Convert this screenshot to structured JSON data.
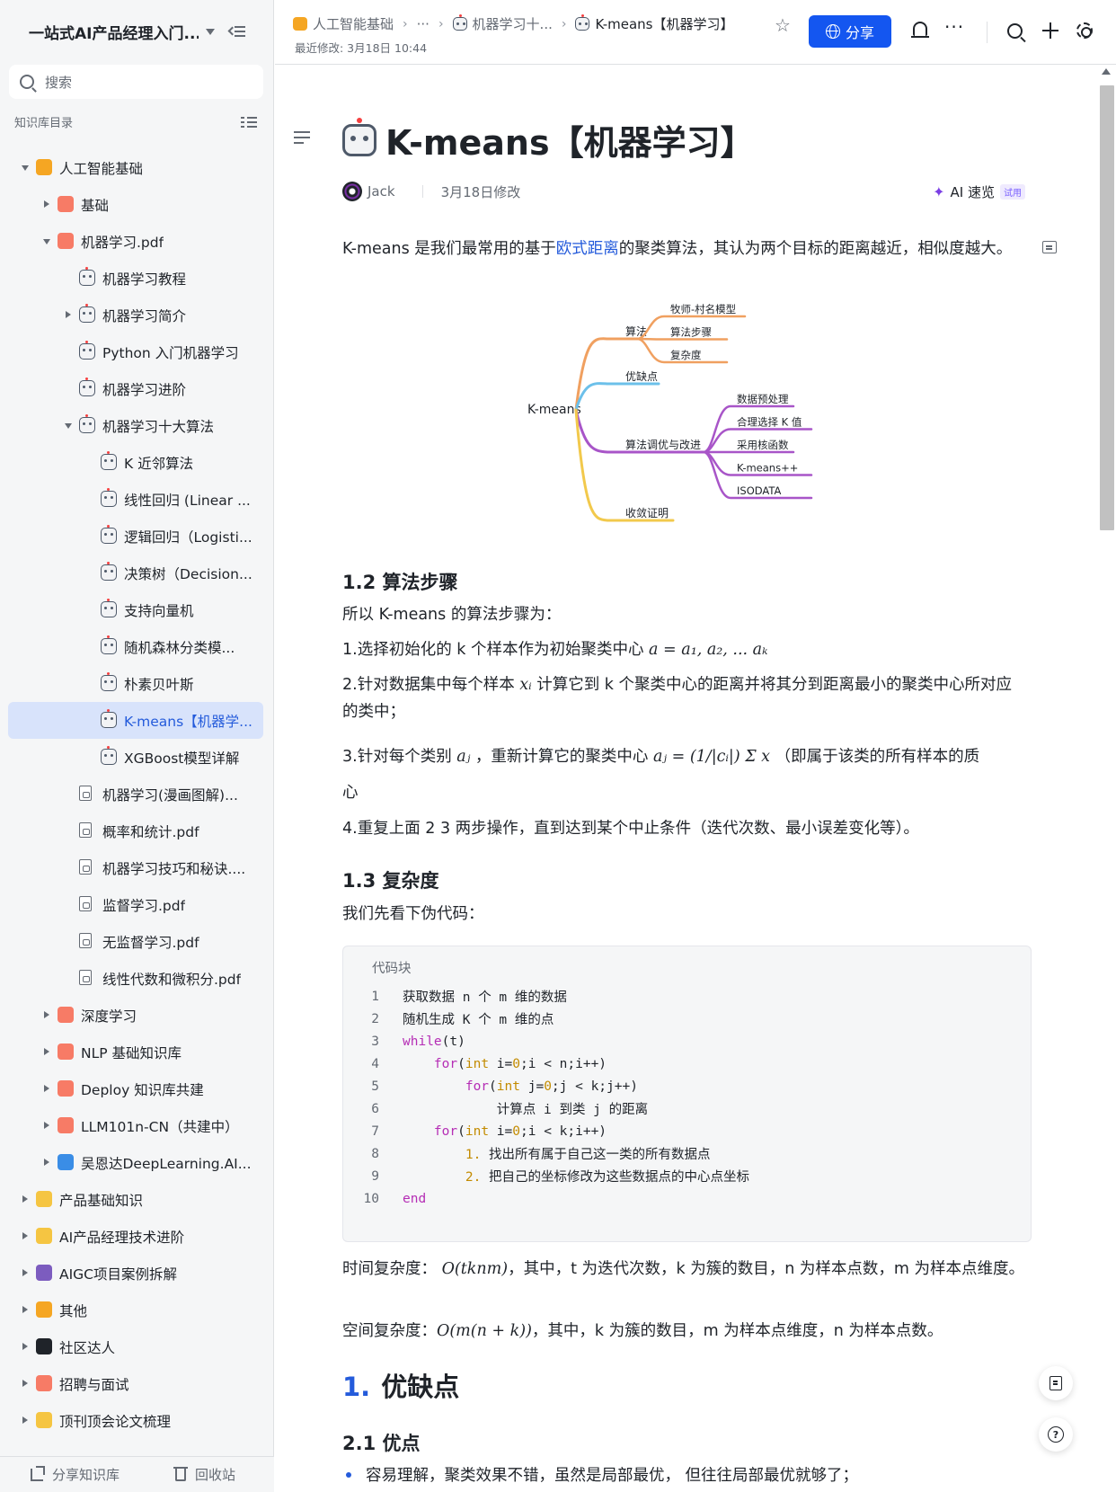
{
  "sidebar": {
    "title": "一站式AI产品经理入门...",
    "search_placeholder": "搜索",
    "section_label": "知识库目录",
    "items": [
      {
        "label": "人工智能基础",
        "level": 0,
        "arrow": "down",
        "icon": "smile-heart-icon",
        "icon_color": "#f5a623"
      },
      {
        "label": "基础",
        "level": 1,
        "arrow": "right",
        "icon": "grid-icon",
        "icon_color": "#f77b66"
      },
      {
        "label": "机器学习.pdf",
        "level": 1,
        "arrow": "down",
        "icon": "layers-icon",
        "icon_color": "#f77b66"
      },
      {
        "label": "机器学习教程",
        "level": 2,
        "arrow": "",
        "icon": "robot-icon"
      },
      {
        "label": "机器学习简介",
        "level": 2,
        "arrow": "right",
        "icon": "robot-icon"
      },
      {
        "label": "Python 入门机器学习",
        "level": 2,
        "arrow": "",
        "icon": "robot-icon"
      },
      {
        "label": "机器学习进阶",
        "level": 2,
        "arrow": "",
        "icon": "robot-icon"
      },
      {
        "label": "机器学习十大算法",
        "level": 2,
        "arrow": "down",
        "icon": "robot-icon"
      },
      {
        "label": "K 近邻算法",
        "level": 3,
        "arrow": "",
        "icon": "robot-icon"
      },
      {
        "label": "线性回归 (Linear ...",
        "level": 3,
        "arrow": "",
        "icon": "robot-icon"
      },
      {
        "label": "逻辑回归（Logisti...",
        "level": 3,
        "arrow": "",
        "icon": "robot-icon"
      },
      {
        "label": "决策树（Decision...",
        "level": 3,
        "arrow": "",
        "icon": "robot-icon"
      },
      {
        "label": "支持向量机",
        "level": 3,
        "arrow": "",
        "icon": "robot-icon"
      },
      {
        "label": "随机森林分类模...",
        "level": 3,
        "arrow": "",
        "icon": "robot-icon"
      },
      {
        "label": "朴素贝叶斯",
        "level": 3,
        "arrow": "",
        "icon": "robot-icon"
      },
      {
        "label": "K-means【机器学...",
        "level": 3,
        "arrow": "",
        "icon": "robot-icon",
        "active": true
      },
      {
        "label": "XGBoost模型详解",
        "level": 3,
        "arrow": "",
        "icon": "robot-icon"
      },
      {
        "label": "机器学习(漫画图解)...",
        "level": 2,
        "arrow": "",
        "icon": "pdf-icon"
      },
      {
        "label": "概率和统计.pdf",
        "level": 2,
        "arrow": "",
        "icon": "pdf-icon"
      },
      {
        "label": "机器学习技巧和秘诀....",
        "level": 2,
        "arrow": "",
        "icon": "pdf-icon"
      },
      {
        "label": "监督学习.pdf",
        "level": 2,
        "arrow": "",
        "icon": "pdf-icon"
      },
      {
        "label": "无监督学习.pdf",
        "level": 2,
        "arrow": "",
        "icon": "pdf-icon"
      },
      {
        "label": "线性代数和微积分.pdf",
        "level": 2,
        "arrow": "",
        "icon": "pdf-icon"
      },
      {
        "label": "深度学习",
        "level": 1,
        "arrow": "right",
        "icon": "layers-icon",
        "icon_color": "#f77b66"
      },
      {
        "label": "NLP 基础知识库",
        "level": 1,
        "arrow": "right",
        "icon": "layers-icon",
        "icon_color": "#f77b66"
      },
      {
        "label": "Deploy 知识库共建",
        "level": 1,
        "arrow": "right",
        "icon": "chart-icon",
        "icon_color": "#f77b66"
      },
      {
        "label": "LLM101n-CN（共建中）",
        "level": 1,
        "arrow": "right",
        "icon": "monitor-icon",
        "icon_color": "#f77b66"
      },
      {
        "label": "吴恩达DeepLearning.AI...",
        "level": 1,
        "arrow": "right",
        "icon": "teacher-icon",
        "icon_color": "#3a8de6"
      },
      {
        "label": "产品基础知识",
        "level": 0,
        "arrow": "right",
        "icon": "dizzy-icon",
        "icon_color": "#f5c542"
      },
      {
        "label": "AI产品经理技术进阶",
        "level": 0,
        "arrow": "right",
        "icon": "muscle-icon",
        "icon_color": "#f5c542"
      },
      {
        "label": "AIGC项目案例拆解",
        "level": 0,
        "arrow": "right",
        "icon": "floppy-icon",
        "icon_color": "#7c5cbf"
      },
      {
        "label": "其他",
        "level": 0,
        "arrow": "right",
        "icon": "box-icon",
        "icon_color": "#f5a623"
      },
      {
        "label": "社区达人",
        "level": 0,
        "arrow": "right",
        "icon": "eyes-icon",
        "icon_color": "#1f2329"
      },
      {
        "label": "招聘与面试",
        "level": 0,
        "arrow": "right",
        "icon": "mail-icon",
        "icon_color": "#f77b66"
      },
      {
        "label": "顶刊顶会论文梳理",
        "level": 0,
        "arrow": "right",
        "icon": "scroll-icon",
        "icon_color": "#f5c542"
      }
    ],
    "footer": {
      "share_label": "分享知识库",
      "trash_label": "回收站"
    }
  },
  "topbar": {
    "crumbs": [
      {
        "label": "人工智能基础",
        "icon": "smile-heart-icon"
      },
      {
        "label": "···",
        "icon": ""
      },
      {
        "label": "机器学习十...",
        "icon": "robot-icon"
      },
      {
        "label": "K-means【机器学习】",
        "icon": "robot-icon",
        "current": true
      }
    ],
    "modified": "最近修改: 3月18日 10:44",
    "share_label": "分享",
    "accent": "#1456f0"
  },
  "doc": {
    "title": "K-means【机器学习】",
    "author": "Jack",
    "modified": "3月18日修改",
    "ai_read": "AI 速览",
    "trial": "试用",
    "intro_a": "K-means 是我们最常用的基于",
    "intro_link": "欧式距离",
    "intro_b": "的聚类算法，其认为两个目标的距离越近，相似度越大。",
    "mindmap": {
      "root": "K-means",
      "branches": [
        {
          "label": "算法",
          "color": "#f0a060",
          "children": [
            "牧师-村名模型",
            "算法步骤",
            "复杂度"
          ]
        },
        {
          "label": "优缺点",
          "color": "#6cc0ea",
          "children": []
        },
        {
          "label": "算法调优与改进",
          "color": "#a855c8",
          "children": [
            "数据预处理",
            "合理选择 K 值",
            "采用核函数",
            "K-means++",
            "ISODATA"
          ]
        },
        {
          "label": "收敛证明",
          "color": "#f2c94c",
          "children": []
        }
      ]
    },
    "h_steps": "1.2 算法步骤",
    "steps_intro": "所以 K-means 的算法步骤为：",
    "step1": "1.选择初始化的 k 个样本作为初始聚类中心",
    "step1_math": "a = a₁, a₂, ... aₖ",
    "step2_a": "2.针对数据集中每个样本",
    "step2_math": "xᵢ",
    "step2_b": "计算它到 k 个聚类中心的距离并将其分到距离最小的聚类中心所对应的类中；",
    "step3_a": "3.针对每个类别",
    "step3_math1": "aⱼ",
    "step3_b": "，重新计算它的聚类中心",
    "step3_math2": "aⱼ = (1/|cᵢ|) Σ x",
    "step3_c": "（即属于该类的所有样本的质",
    "step3_d": "心",
    "step4": "4.重复上面 2 3 两步操作，直到达到某个中止条件（迭代次数、最小误差变化等）。",
    "h_complexity": "1.3 复杂度",
    "pseudo_intro": "我们先看下伪代码：",
    "code_label": "代码块",
    "code": [
      "获取数据 n 个 m 维的数据",
      "随机生成 K 个 m 维的点",
      "while(t)",
      "    for(int i=0;i < n;i++)",
      "        for(int j=0;j < k;j++)",
      "            计算点 i 到类 j 的距离",
      "    for(int i=0;i < k;i++)",
      "        1. 找出所有属于自己这一类的所有数据点",
      "        2. 把自己的坐标修改为这些数据点的中心点坐标",
      "end"
    ],
    "time_a": "时间复杂度：",
    "time_math": "O(tknm)",
    "time_b": "，其中，t 为迭代次数，k 为簇的数目，n 为样本点数，m 为样本点维度。",
    "space_a": "空间复杂度：",
    "space_math": "O(m(n + k))",
    "space_b": "，其中，k 为簇的数目，m 为样本点维度，n 为样本点数。",
    "h1_num": "1.",
    "h1_text": "优缺点",
    "h_pros": "2.1 优点",
    "pro1": "容易理解，聚类效果不错，虽然是局部最优， 但往往局部最优就够了；"
  }
}
